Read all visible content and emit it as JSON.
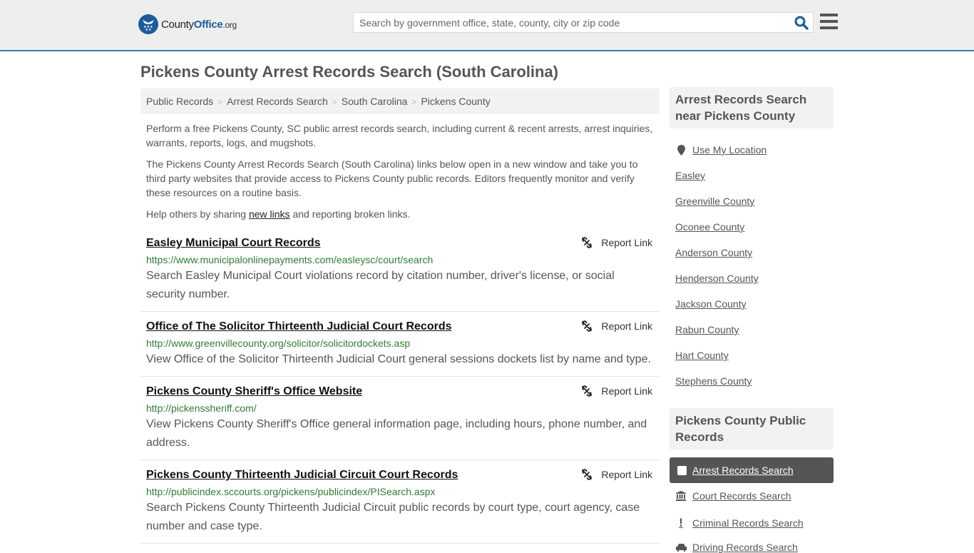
{
  "header": {
    "logo": {
      "name_part1": "County",
      "name_part2": "Office",
      "name_part3": ".org"
    },
    "search": {
      "placeholder": "Search by government office, state, county, city or zip code",
      "value": ""
    }
  },
  "page_title": "Pickens County Arrest Records Search (South Carolina)",
  "breadcrumb": [
    {
      "label": "Public Records"
    },
    {
      "label": "Arrest Records Search"
    },
    {
      "label": "South Carolina"
    },
    {
      "label": "Pickens County"
    }
  ],
  "breadcrumb_separator": ">",
  "intro": {
    "p1": "Perform a free Pickens County, SC public arrest records search, including current & recent arrests, arrest inquiries, warrants, reports, logs, and mugshots.",
    "p2": "The Pickens County Arrest Records Search (South Carolina) links below open in a new window and take you to third party websites that provide access to Pickens County public records. Editors frequently monitor and verify these resources on a routine basis.",
    "p3_before": "Help others by sharing ",
    "p3_link": "new links",
    "p3_after": " and reporting broken links."
  },
  "report_label": "Report Link",
  "results": [
    {
      "title": "Easley Municipal Court Records",
      "url": "https://www.municipalonlinepayments.com/easleysc/court/search",
      "description": "Search Easley Municipal Court violations record by citation number, driver's license, or social security number."
    },
    {
      "title": "Office of The Solicitor Thirteenth Judicial Court Records",
      "url": "http://www.greenvillecounty.org/solicitor/solicitordockets.asp",
      "description": "View Office of the Solicitor Thirteenth Judicial Court general sessions dockets list by name and type."
    },
    {
      "title": "Pickens County Sheriff's Office Website",
      "url": "http://pickenssheriff.com/",
      "description": "View Pickens County Sheriff's Office general information page, including hours, phone number, and address."
    },
    {
      "title": "Pickens County Thirteenth Judicial Circuit Court Records",
      "url": "http://publicindex.sccourts.org/pickens/publicindex/PISearch.aspx",
      "description": "Search Pickens County Thirteenth Judicial Circuit public records by court type, court agency, case number and case type."
    }
  ],
  "sidebar": {
    "nearby": {
      "heading": "Arrest Records Search near Pickens County",
      "use_location": "Use My Location",
      "links": [
        "Easley",
        "Greenville County",
        "Oconee County",
        "Anderson County",
        "Henderson County",
        "Jackson County",
        "Rabun County",
        "Hart County",
        "Stephens County"
      ]
    },
    "public_records": {
      "heading": "Pickens County Public Records",
      "items": [
        {
          "label": "Arrest Records Search",
          "icon": "square-icon",
          "active": true
        },
        {
          "label": "Court Records Search",
          "icon": "courthouse-icon",
          "active": false
        },
        {
          "label": "Criminal Records Search",
          "icon": "exclamation-icon",
          "active": false
        },
        {
          "label": "Driving Records Search",
          "icon": "car-icon",
          "active": false
        }
      ]
    }
  },
  "colors": {
    "accent": "#1c5c9c",
    "header_border": "#3a7aa8",
    "url_green": "#2e7d32",
    "active_bg": "#555555"
  }
}
